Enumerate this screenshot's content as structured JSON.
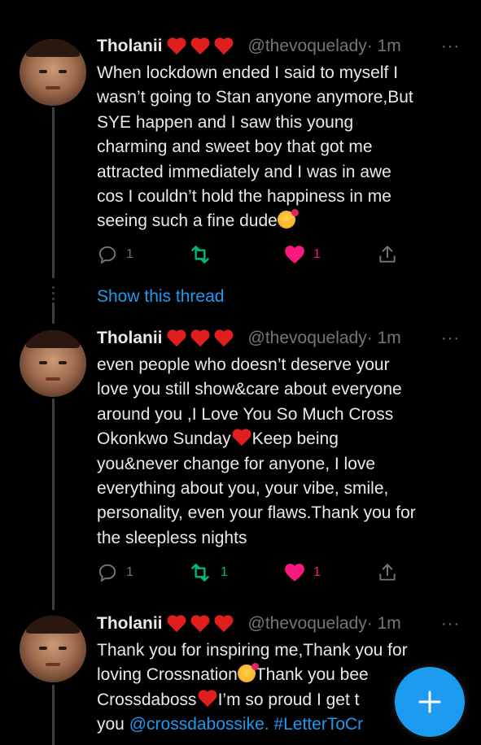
{
  "tweets": [
    {
      "name": "Tholanii",
      "handle": "@thevoquelady",
      "time": "· 1m",
      "more": "···",
      "text_lines": [
        "When lockdown ended I said to myself I",
        "wasn’t going to Stan anyone anymore,But",
        "SYE happen and I saw this young",
        "charming and sweet boy that got me",
        "attracted immediately and I was in awe",
        "cos I couldn’t hold the happiness in me",
        "seeing such a fine dude"
      ],
      "reply_count": "1",
      "retweet_count": "",
      "like_count": "1"
    },
    {
      "name": "Tholanii",
      "handle": "@thevoquelady",
      "time": "· 1m",
      "more": "···",
      "text_lines": [
        "even people who doesn’t deserve your",
        "love you still show&care about everyone",
        "around you ,I Love You So Much Cross",
        "Okonkwo Sunday",
        "Keep being",
        "you&never change for anyone, I love",
        "everything about you, your vibe, smile,",
        "personality, even your flaws.Thank you for",
        "the sleepless nights"
      ],
      "reply_count": "1",
      "retweet_count": "1",
      "like_count": "1"
    },
    {
      "name": "Tholanii",
      "handle": "@thevoquelady",
      "time": "· 1m",
      "more": "···",
      "text_lines": [
        "Thank you for inspiring me,Thank you for",
        "loving Crossnation",
        "Thank you bee",
        "Crossdaboss",
        "I’m so proud I get t",
        "you ",
        "@crossdabossike.",
        "#LetterToCr"
      ]
    }
  ],
  "show_thread_label": "Show this thread",
  "colors": {
    "background": "#000000",
    "link": "#1d9bf0",
    "retweet": "#00ba7c",
    "like": "#f91880",
    "muted": "#71767b"
  },
  "icons": [
    "reply-icon",
    "retweet-icon",
    "like-icon",
    "share-icon",
    "compose-icon",
    "heart-emoji",
    "smiling-hearts-emoji"
  ]
}
